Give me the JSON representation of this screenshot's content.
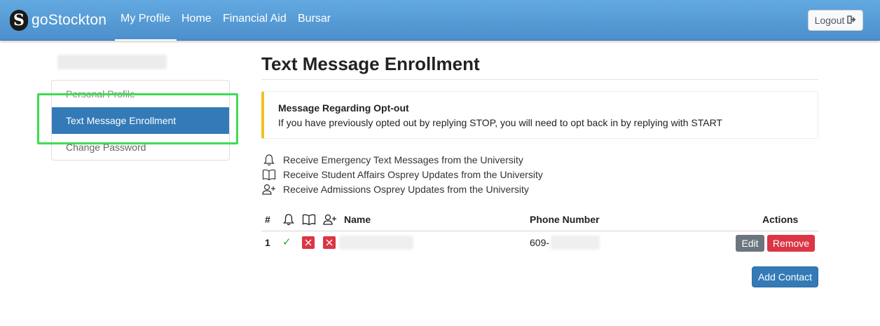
{
  "navbar": {
    "brand_letter": "S",
    "brand_text": "goStockton",
    "items": [
      {
        "label": "My Profile",
        "active": true
      },
      {
        "label": "Home",
        "active": false
      },
      {
        "label": "Financial Aid",
        "active": false
      },
      {
        "label": "Bursar",
        "active": false
      }
    ],
    "logout_label": "Logout"
  },
  "sidebar": {
    "items": [
      {
        "label": "Personal Profile",
        "active": false
      },
      {
        "label": "Text Message Enrollment",
        "active": true
      },
      {
        "label": "Change Password",
        "active": false
      }
    ],
    "highlight_color": "#3ddc53"
  },
  "main": {
    "title": "Text Message Enrollment",
    "callout": {
      "title": "Message Regarding Opt-out",
      "text": "If you have previously opted out by replying STOP, you will need to opt back in by replying with START"
    },
    "legend": [
      {
        "icon": "bell-icon",
        "text": "Receive Emergency Text Messages from the University"
      },
      {
        "icon": "book-icon",
        "text": "Receive Student Affairs Osprey Updates from the University"
      },
      {
        "icon": "user-plus-icon",
        "text": "Receive Admissions Osprey Updates from the University"
      }
    ],
    "table": {
      "headers": {
        "number": "#",
        "name": "Name",
        "phone": "Phone Number",
        "actions": "Actions"
      },
      "rows": [
        {
          "number": "1",
          "emergency": "check",
          "student_affairs": "x",
          "admissions": "x",
          "phone_prefix": "609-",
          "edit_label": "Edit",
          "remove_label": "Remove"
        }
      ]
    },
    "add_contact_label": "Add Contact"
  },
  "colors": {
    "navbar": "#4c8fcb",
    "primary": "#337ab7",
    "danger": "#dc3545",
    "secondary": "#6c757d",
    "success": "#28a745",
    "warning": "#f0c020"
  }
}
